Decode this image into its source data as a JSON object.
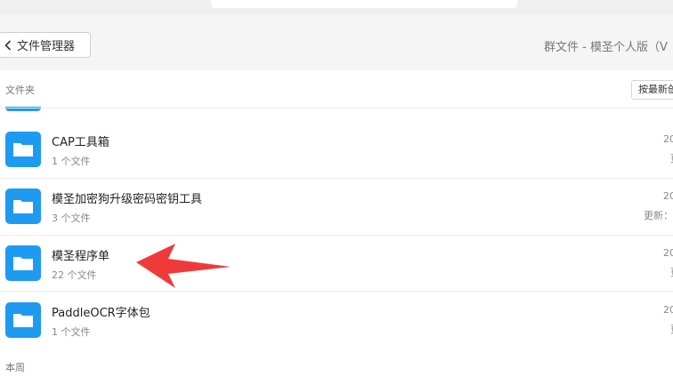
{
  "header": {
    "back_label": "文件管理器",
    "breadcrumb": "群文件 - 模圣个人版（V"
  },
  "list": {
    "section_folders": "文件夹",
    "sort_label": "按最新创",
    "section_this_week": "本周",
    "folders": [
      {
        "name": "CAP工具箱",
        "count": "1 个文件",
        "date": "20",
        "updated": "更"
      },
      {
        "name": "模圣加密狗升级密码密钥工具",
        "count": "3 个文件",
        "date": "20",
        "updated": "更新："
      },
      {
        "name": "模圣程序单",
        "count": "22 个文件",
        "date": "20",
        "updated": "更"
      },
      {
        "name": "PaddleOCR字体包",
        "count": "1 个文件",
        "date": "20",
        "updated": "更"
      }
    ]
  },
  "colors": {
    "folder_icon": "#1e9bf0",
    "annotation_arrow": "#f03a3a"
  }
}
